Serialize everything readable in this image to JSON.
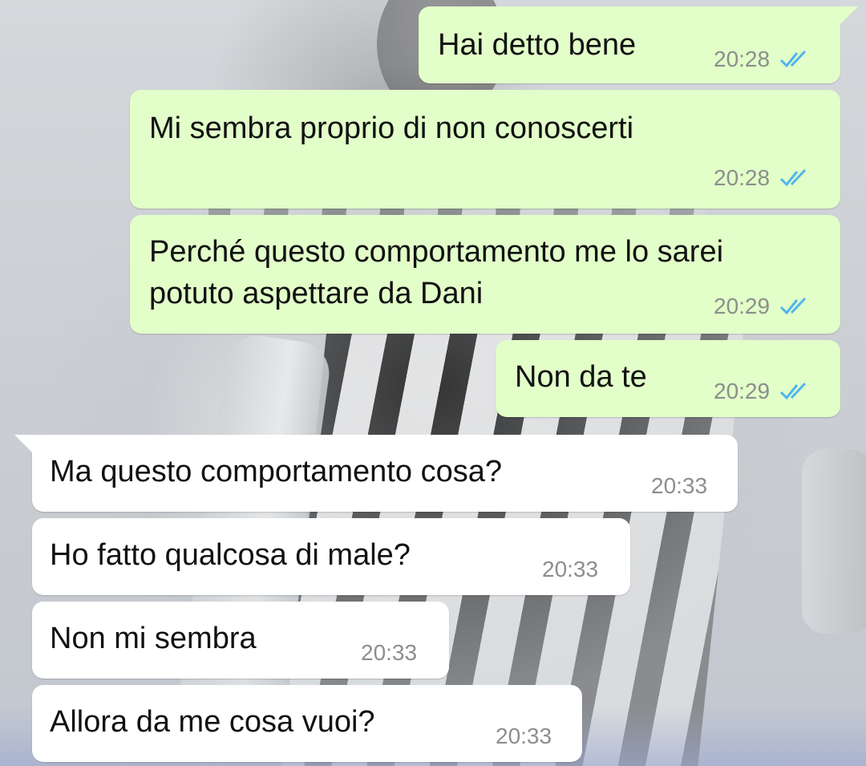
{
  "messages": [
    {
      "direction": "outgoing",
      "text": "Hai detto bene",
      "time": "20:28",
      "status": "read"
    },
    {
      "direction": "outgoing",
      "text": "Mi sembra proprio di non conoscerti",
      "time": "20:28",
      "status": "read"
    },
    {
      "direction": "outgoing",
      "text_line1": "Perché questo comportamento me lo sarei",
      "text_line2": "potuto aspettare da Dani",
      "time": "20:29",
      "status": "read"
    },
    {
      "direction": "outgoing",
      "text": "Non da te",
      "time": "20:29",
      "status": "read"
    },
    {
      "direction": "incoming",
      "text": "Ma questo comportamento cosa?",
      "time": "20:33"
    },
    {
      "direction": "incoming",
      "text": "Ho fatto qualcosa di male?",
      "time": "20:33"
    },
    {
      "direction": "incoming",
      "text": "Non mi sembra",
      "time": "20:33"
    },
    {
      "direction": "incoming",
      "text": "Allora da me cosa vuoi?",
      "time": "20:33"
    }
  ],
  "colors": {
    "outgoing_bubble": "#e2fec9",
    "incoming_bubble": "#ffffff",
    "read_ticks": "#4fb6ec",
    "timestamp": "#8c8f8c"
  },
  "icons": {
    "read_receipt": "double-check-icon"
  }
}
